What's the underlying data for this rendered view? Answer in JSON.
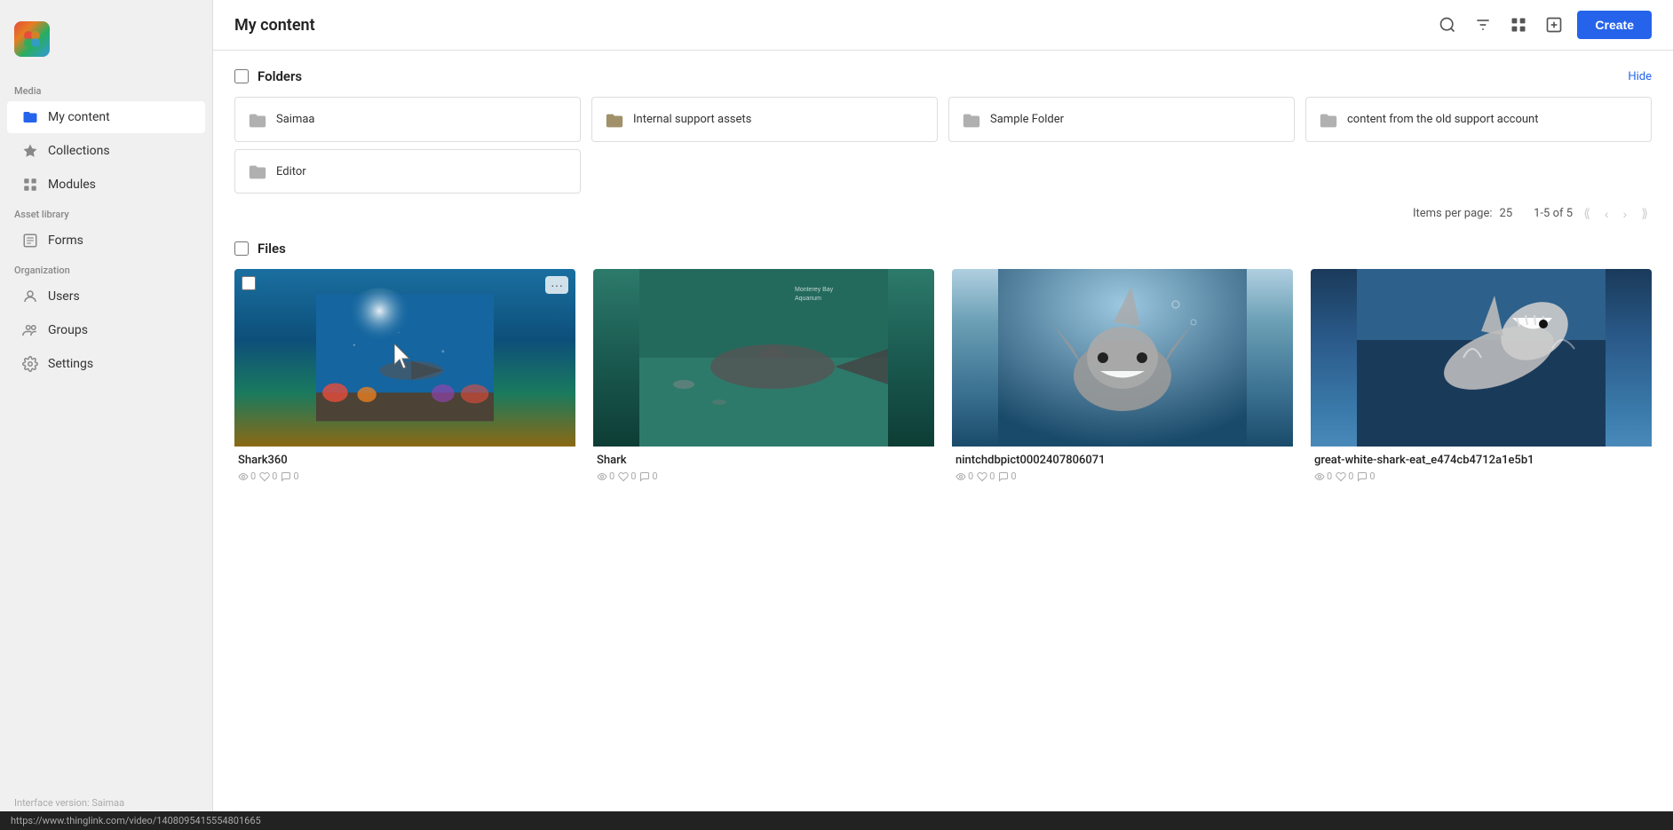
{
  "app": {
    "logo_emoji": "🎨"
  },
  "sidebar": {
    "media_label": "Media",
    "my_content_label": "My content",
    "collections_label": "Collections",
    "modules_label": "Modules",
    "asset_library_label": "Asset library",
    "forms_label": "Forms",
    "organization_label": "Organization",
    "users_label": "Users",
    "groups_label": "Groups",
    "settings_label": "Settings",
    "interface_version_label": "Interface version: Saimaa"
  },
  "header": {
    "title": "My content",
    "create_label": "Create"
  },
  "folders": {
    "section_title": "Folders",
    "hide_label": "Hide",
    "items": [
      {
        "name": "Saimaa"
      },
      {
        "name": "Internal support assets"
      },
      {
        "name": "Sample Folder"
      },
      {
        "name": "content from the old support account"
      },
      {
        "name": "Editor"
      }
    ],
    "pagination": {
      "items_per_page_label": "Items per page:",
      "items_per_page_value": "25",
      "range_label": "1-5 of 5"
    }
  },
  "files": {
    "section_title": "Files",
    "items": [
      {
        "name": "Shark360",
        "views": "0",
        "likes": "0",
        "comments": "0",
        "img_type": "shark360"
      },
      {
        "name": "Shark",
        "views": "0",
        "likes": "0",
        "comments": "0",
        "img_type": "shark-plain"
      },
      {
        "name": "nintchdbpict0002407806071",
        "views": "0",
        "likes": "0",
        "comments": "0",
        "img_type": "shark-front"
      },
      {
        "name": "great-white-shark-eat_e474cb4712a1e5b1",
        "views": "0",
        "likes": "0",
        "comments": "0",
        "img_type": "shark-eat"
      }
    ]
  },
  "status_bar": {
    "url": "https://www.thinglink.com/video/1408095415554801665"
  }
}
